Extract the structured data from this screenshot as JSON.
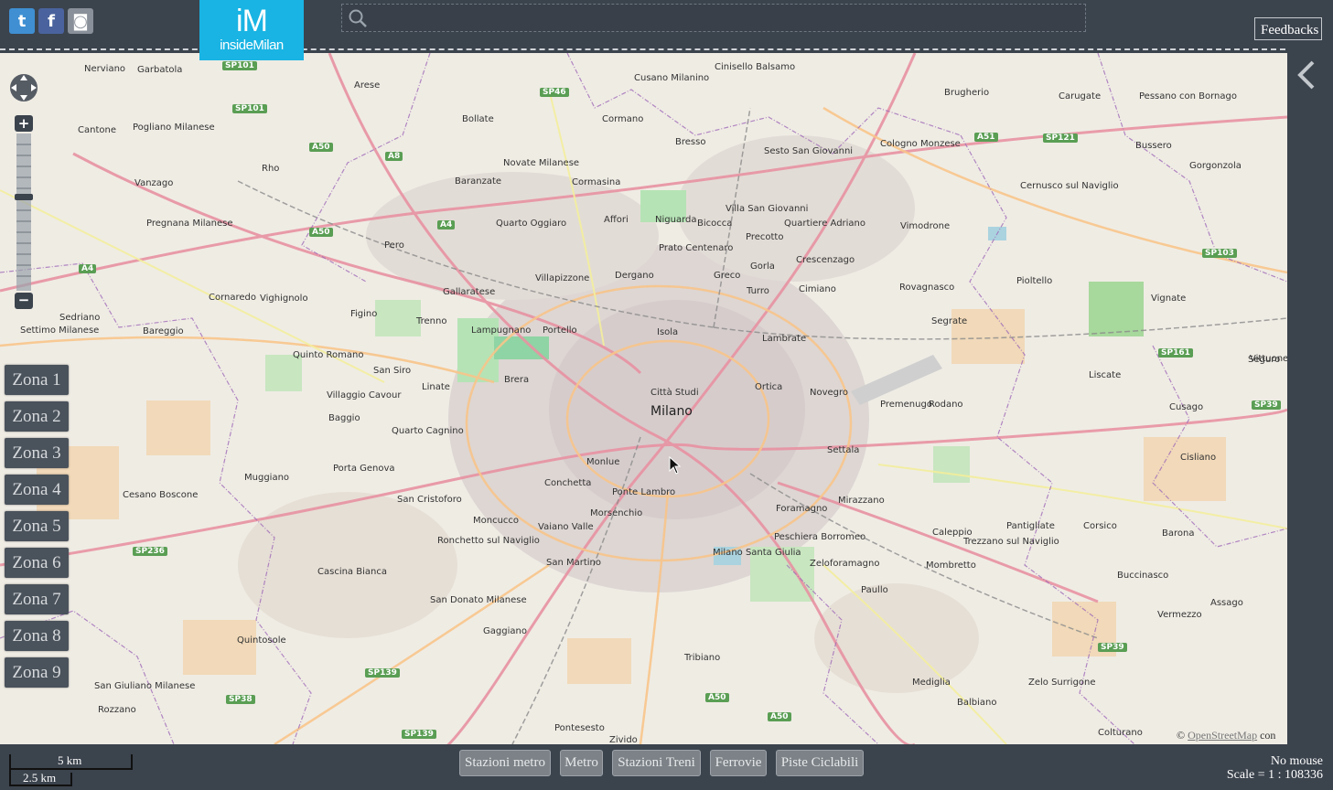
{
  "header": {
    "social": [
      {
        "icon": "twitter-icon",
        "glyph": "t"
      },
      {
        "icon": "facebook-icon",
        "glyph": "f"
      },
      {
        "icon": "github-icon",
        "glyph": "◙"
      }
    ],
    "logo_mark": "iM",
    "logo_text": "insideMilan",
    "search_value": "",
    "feedback_label": "Feedbacks"
  },
  "zones": [
    "Zona 1",
    "Zona 2",
    "Zona 3",
    "Zona 4",
    "Zona 5",
    "Zona 6",
    "Zona 7",
    "Zona 8",
    "Zona 9"
  ],
  "map": {
    "city_label": "Milano",
    "places": [
      "Nerviano",
      "Garbatola",
      "Arese",
      "Cusano Milanino",
      "Cinisello Balsamo",
      "Sesto San Giovanni",
      "Brugherio",
      "Carugate",
      "Pessano con Bornago",
      "Bollate",
      "Cormano",
      "Bresso",
      "Cologno Monzese",
      "Bussero",
      "Gorgonzola",
      "Cantone",
      "Pogliano Milanese",
      "Rho",
      "Novate Milanese",
      "Cernusco sul Naviglio",
      "Vanzago",
      "Baranzate",
      "Cormasina",
      "Affori",
      "Niguarda",
      "Bicocca",
      "Villa San Giovanni",
      "Quartiere Adriano",
      "Vimodrone",
      "Pregnana Milanese",
      "Quarto Oggiaro",
      "Prato Centenaro",
      "Precotto",
      "Crescenzago",
      "Pero",
      "Villapizzone",
      "Dergano",
      "Greco",
      "Gorla",
      "Pioltello",
      "Vignate",
      "Cornaredo",
      "Vighignolo",
      "Figino",
      "Gallaratese",
      "Turro",
      "Cimiano",
      "Rovagnasco",
      "Sedriano",
      "Bareggio",
      "Trenno",
      "Lampugnano",
      "Portello",
      "Isola",
      "Lambrate",
      "Segrate",
      "Vittuone",
      "Settimo Milanese",
      "Quinto Romano",
      "San Siro",
      "Brera",
      "Città Studi",
      "Ortica",
      "Novegro",
      "Rodano",
      "Liscate",
      "Seguro",
      "Villaggio Cavour",
      "Baggio",
      "Quarto Cagnino",
      "Linate",
      "Premenugo",
      "Cusago",
      "Muggiano",
      "Porta Genova",
      "Monlue",
      "Settala",
      "Cisliano",
      "Cesano Boscone",
      "San Cristoforo",
      "Conchetta",
      "Ponte Lambro",
      "Mirazzano",
      "Pantigliate",
      "Corsico",
      "Ronchetto sul Naviglio",
      "Moncucco",
      "Morsenchio",
      "Foramagno",
      "Caleppio",
      "Barona",
      "Vaiano Valle",
      "Milano Santa Giulia",
      "Peschiera Borromeo",
      "Trezzano sul Naviglio",
      "Cascina Bianca",
      "San Martino",
      "Zeloforamagno",
      "Mombretto",
      "Buccinasco",
      "San Donato Milanese",
      "Paullo",
      "Assago",
      "Gaggiano",
      "Quintosole",
      "Tribiano",
      "Vermezzo",
      "San Giuliano Milanese",
      "Mediglia",
      "Zelo Surrigone",
      "Rozzano",
      "Pontesesto",
      "Zivido",
      "Balbiano",
      "Colturano"
    ],
    "roads": [
      "SP101",
      "SP46",
      "SP101",
      "A50",
      "A8",
      "A51",
      "SP121",
      "A4",
      "A50",
      "SP103",
      "A4",
      "SP161",
      "SP39",
      "SP236",
      "SP39",
      "SP139",
      "SP38",
      "A50",
      "SP139",
      "A50"
    ],
    "attribution_prefix": "©",
    "attribution_link": "OpenStreetMap",
    "attribution_suffix": "con"
  },
  "scale": {
    "large": "5 km",
    "small": "2.5 km"
  },
  "layers": [
    "Stazioni metro",
    "Metro",
    "Stazioni Treni",
    "Ferrovie",
    "Piste Ciclabili"
  ],
  "status": {
    "mouse": "No mouse",
    "scale": "Scale = 1 : 108336"
  },
  "colors": {
    "bar": "#3b434d",
    "logo": "#19b4e3",
    "zone_button": "#4a525b",
    "layer_button": "#7c8287"
  }
}
